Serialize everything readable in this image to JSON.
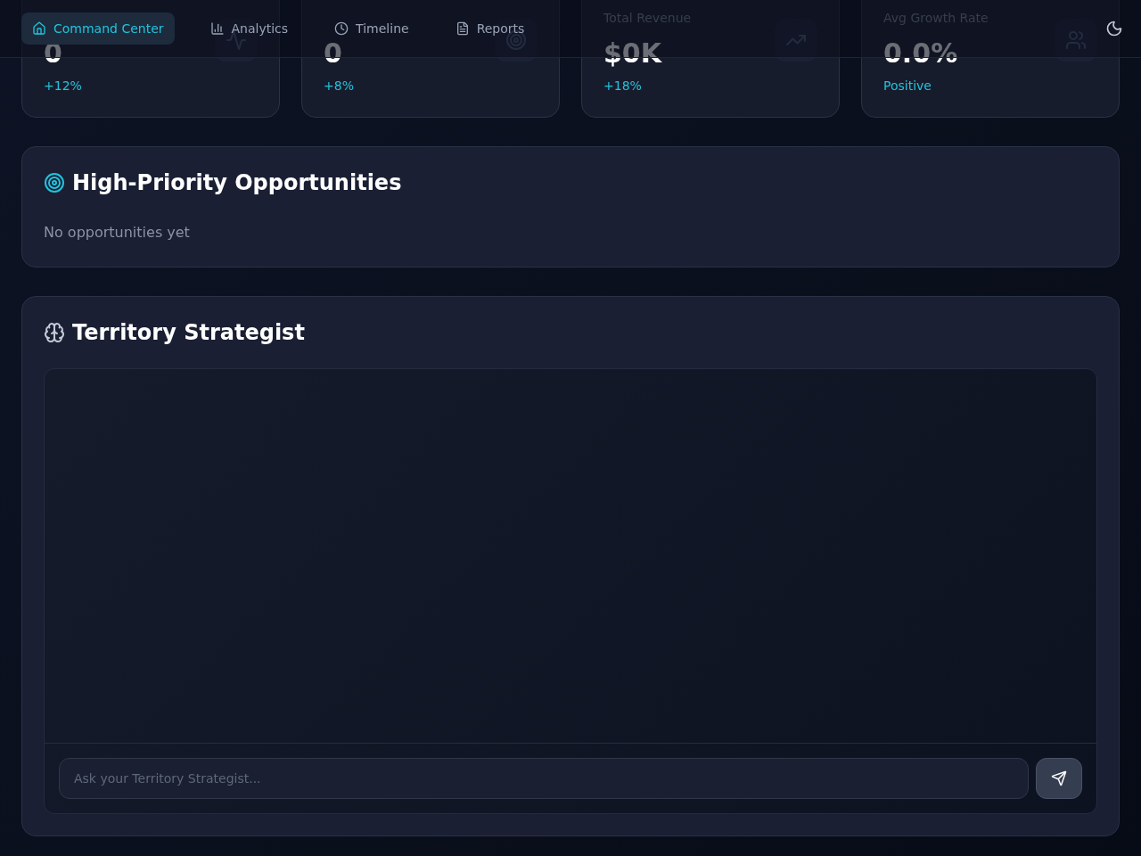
{
  "nav": {
    "tabs": [
      {
        "label": "Command Center",
        "selected": true
      },
      {
        "label": "Analytics",
        "selected": false
      },
      {
        "label": "Timeline",
        "selected": false
      },
      {
        "label": "Reports",
        "selected": false
      }
    ]
  },
  "stats": [
    {
      "value": "0",
      "change": "+12%"
    },
    {
      "value": "0",
      "change": "+8%"
    },
    {
      "label": "Total Revenue",
      "value": "$0K",
      "change": "+18%"
    },
    {
      "label": "Avg Growth Rate",
      "value": "0.0%",
      "change": "Positive"
    }
  ],
  "opportunities": {
    "title": "High-Priority Opportunities",
    "empty_text": "No opportunities yet"
  },
  "strategist": {
    "title": "Territory Strategist",
    "input": {
      "placeholder": "Ask your Territory Strategist..."
    }
  }
}
